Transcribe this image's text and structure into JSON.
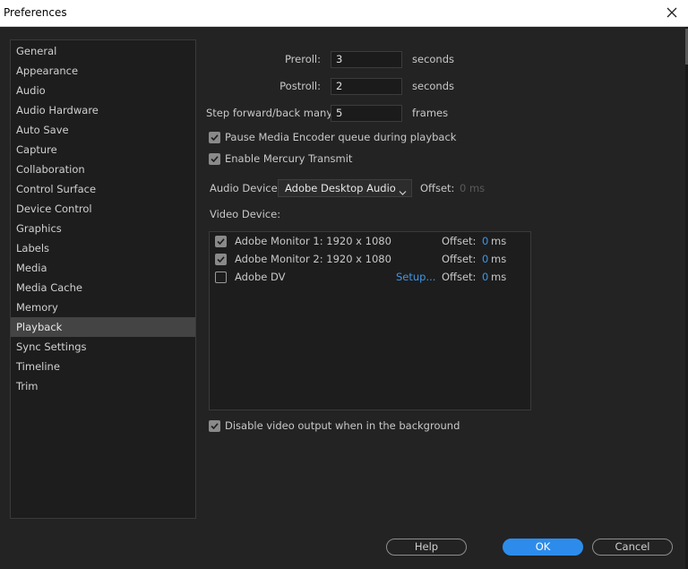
{
  "window": {
    "title": "Preferences"
  },
  "sidebar": {
    "items": [
      {
        "label": "General"
      },
      {
        "label": "Appearance"
      },
      {
        "label": "Audio"
      },
      {
        "label": "Audio Hardware"
      },
      {
        "label": "Auto Save"
      },
      {
        "label": "Capture"
      },
      {
        "label": "Collaboration"
      },
      {
        "label": "Control Surface"
      },
      {
        "label": "Device Control"
      },
      {
        "label": "Graphics"
      },
      {
        "label": "Labels"
      },
      {
        "label": "Media"
      },
      {
        "label": "Media Cache"
      },
      {
        "label": "Memory"
      },
      {
        "label": "Playback"
      },
      {
        "label": "Sync Settings"
      },
      {
        "label": "Timeline"
      },
      {
        "label": "Trim"
      }
    ],
    "selected": "Playback"
  },
  "playback": {
    "preroll": {
      "label": "Preroll:",
      "value": "3",
      "unit": "seconds"
    },
    "postroll": {
      "label": "Postroll:",
      "value": "2",
      "unit": "seconds"
    },
    "step": {
      "label": "Step forward/back many:",
      "value": "5",
      "unit": "frames"
    },
    "pause_encoder": {
      "label": "Pause Media Encoder queue during playback",
      "checked": true
    },
    "mercury": {
      "label": "Enable Mercury Transmit",
      "checked": true
    },
    "audio_device": {
      "label": "Audio Device:",
      "value": "Adobe Desktop Audio",
      "offset_label": "Offset:",
      "offset_value": "0 ms"
    },
    "video_device_label": "Video Device:",
    "video_devices": [
      {
        "name": "Adobe Monitor 1: 1920 x 1080",
        "checked": true,
        "setup": "",
        "offset_label": "Offset:",
        "offset": "0",
        "unit": "ms"
      },
      {
        "name": "Adobe Monitor 2: 1920 x 1080",
        "checked": true,
        "setup": "",
        "offset_label": "Offset:",
        "offset": "0",
        "unit": "ms"
      },
      {
        "name": "Adobe DV",
        "checked": false,
        "setup": "Setup...",
        "offset_label": "Offset:",
        "offset": "0",
        "unit": "ms"
      }
    ],
    "disable_background": {
      "label": "Disable video output when in the background",
      "checked": true
    }
  },
  "buttons": {
    "help": "Help",
    "ok": "OK",
    "cancel": "Cancel"
  },
  "colors": {
    "accent": "#2d8ceb",
    "link": "#3e97e8",
    "background": "#232323"
  }
}
